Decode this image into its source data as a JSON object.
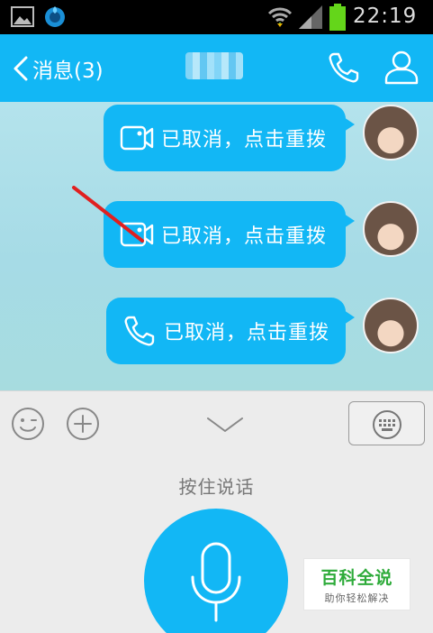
{
  "status_bar": {
    "time": "22:19",
    "battery_color": "#64d61a",
    "icons": [
      "gallery-icon",
      "app-notification-icon",
      "wifi-icon",
      "signal-icon",
      "battery-icon"
    ]
  },
  "header": {
    "back_label": "消息(3)",
    "contact_name": "",
    "icons": [
      "back-chevron-icon",
      "phone-icon",
      "profile-icon"
    ],
    "accent_color": "#12b7f5"
  },
  "messages": [
    {
      "type": "video-call",
      "icon": "video-camera-icon",
      "text": "已取消，点击重拨"
    },
    {
      "type": "video-call",
      "icon": "video-camera-icon",
      "text": "已取消，点击重拨"
    },
    {
      "type": "voice-call",
      "icon": "phone-icon",
      "text": "已取消，点击重拨"
    }
  ],
  "input_panel": {
    "icons": [
      "emoji-icon",
      "plus-icon",
      "chevron-down-icon",
      "keyboard-icon",
      "microphone-icon"
    ],
    "hold_to_talk_label": "按住说话"
  },
  "watermark": {
    "title": "百科全说",
    "subtitle": "助你轻松解决"
  }
}
